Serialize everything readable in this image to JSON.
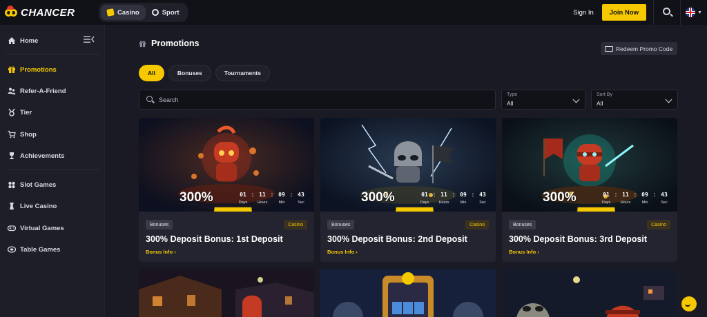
{
  "header": {
    "logo_text": "CHANCER",
    "modes": [
      {
        "label": "Casino",
        "active": true
      },
      {
        "label": "Sport",
        "active": false
      }
    ],
    "signin_label": "Sign In",
    "join_label": "Join Now",
    "accent_color": "#f5c800"
  },
  "sidebar": {
    "items": [
      {
        "label": "Home",
        "icon": "home-icon",
        "active": false
      },
      {
        "label": "Promotions",
        "icon": "gift-icon",
        "active": true
      },
      {
        "label": "Refer-A-Friend",
        "icon": "users-icon",
        "active": false
      },
      {
        "label": "Tier",
        "icon": "medal-icon",
        "active": false
      },
      {
        "label": "Shop",
        "icon": "cart-icon",
        "active": false
      },
      {
        "label": "Achievements",
        "icon": "trophy-icon",
        "active": false
      },
      {
        "label": "Slot Games",
        "icon": "slots-icon",
        "active": false
      },
      {
        "label": "Live Casino",
        "icon": "dealer-icon",
        "active": false
      },
      {
        "label": "Virtual Games",
        "icon": "gamepad-icon",
        "active": false
      },
      {
        "label": "Table Games",
        "icon": "chip-icon",
        "active": false
      }
    ]
  },
  "main": {
    "title": "Promotions",
    "redeem_label": "Redeem Promo Code",
    "filters": [
      {
        "label": "All",
        "active": true
      },
      {
        "label": "Bonuses",
        "active": false
      },
      {
        "label": "Tournaments",
        "active": false
      }
    ],
    "search_placeholder": "Search",
    "type_select": {
      "label": "Type",
      "value": "All"
    },
    "sort_select": {
      "label": "Sort By",
      "value": "All"
    },
    "cards": [
      {
        "tag": "Bonuses",
        "category": "Casino",
        "percent": "300%",
        "title": "300% Deposit Bonus: 1st Deposit",
        "link": "Bonus Info",
        "timer": {
          "days": "01",
          "hours": "11",
          "min": "09",
          "sec": "43"
        }
      },
      {
        "tag": "Bonuses",
        "category": "Casino",
        "percent": "300%",
        "title": "300% Deposit Bonus: 2nd Deposit",
        "link": "Bonus Info",
        "timer": {
          "days": "01",
          "hours": "11",
          "min": "09",
          "sec": "43"
        }
      },
      {
        "tag": "Bonuses",
        "category": "Casino",
        "percent": "300%",
        "title": "300% Deposit Bonus: 3rd Deposit",
        "link": "Bonus Info",
        "timer": {
          "days": "01",
          "hours": "11",
          "min": "09",
          "sec": "43"
        }
      }
    ],
    "timer_labels": {
      "days": "Days",
      "hours": "Hours",
      "min": "Min",
      "sec": "Sec"
    },
    "chevron": "›"
  }
}
